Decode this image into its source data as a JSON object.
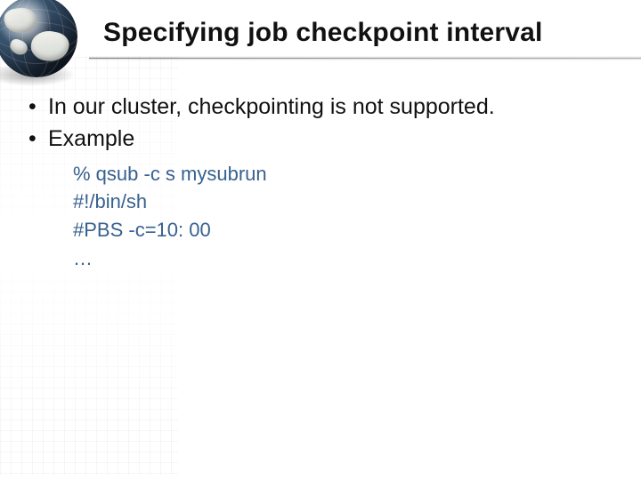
{
  "title": "Specifying job checkpoint interval",
  "bullets": {
    "b1": "In our cluster, checkpointing is not supported.",
    "b2": "Example"
  },
  "code": {
    "l1": "% qsub -c s mysubrun",
    "l2": "#!/bin/sh",
    "l3": "#PBS -c=10: 00",
    "l4": "…"
  }
}
